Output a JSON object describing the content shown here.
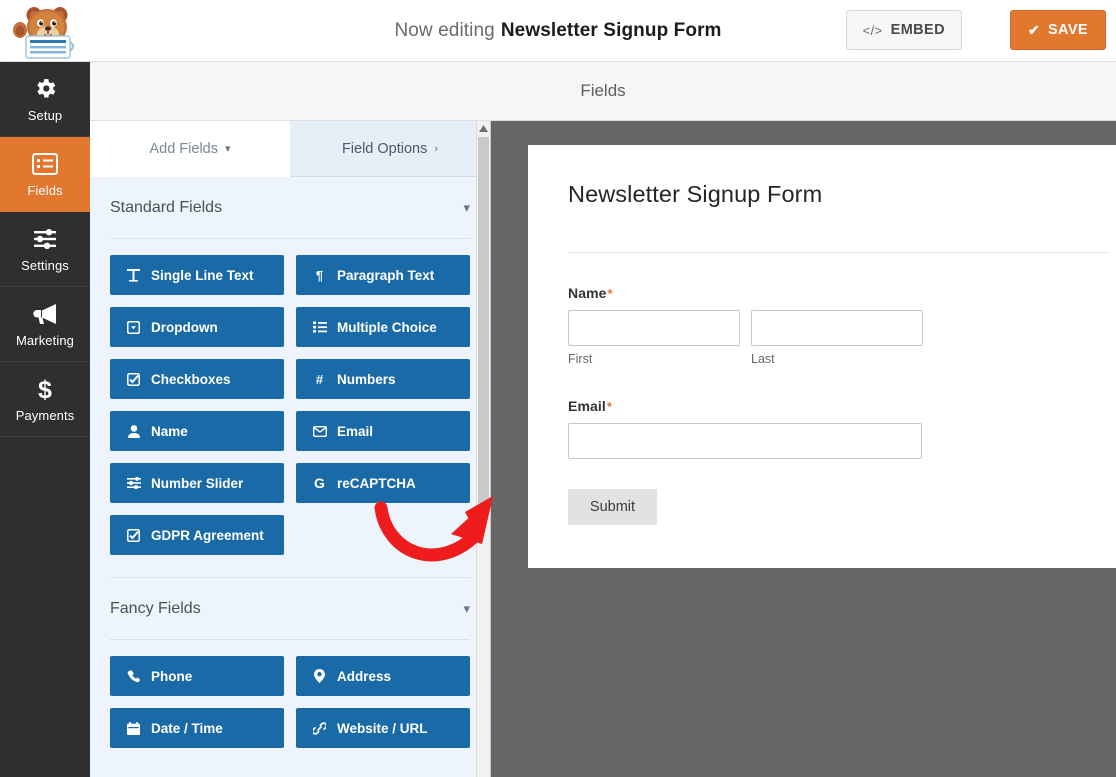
{
  "header": {
    "logo_alt": "wpforms-sullie-mascot",
    "now_editing_prefix": "Now editing",
    "form_name": "Newsletter Signup Form",
    "embed_label": "EMBED",
    "embed_icon": "code-icon",
    "save_label": "SAVE",
    "save_icon": "check-icon",
    "save_color": "#e27730"
  },
  "sidebar": {
    "items": [
      {
        "label": "Setup",
        "icon": "gear-icon",
        "active": false
      },
      {
        "label": "Fields",
        "icon": "list-icon",
        "active": true
      },
      {
        "label": "Settings",
        "icon": "sliders-icon",
        "active": false
      },
      {
        "label": "Marketing",
        "icon": "megaphone-icon",
        "active": false
      },
      {
        "label": "Payments",
        "icon": "dollar-icon",
        "active": false
      }
    ],
    "active_color": "#e27730",
    "background": "#2f2f2f"
  },
  "panel_header": {
    "title": "Fields"
  },
  "field_panel": {
    "tabs": [
      {
        "label": "Add Fields",
        "icon": "chevron-down-icon",
        "active": true
      },
      {
        "label": "Field Options",
        "icon": "chevron-right-icon",
        "active": false
      }
    ],
    "sections": [
      {
        "title": "Standard Fields",
        "caret": "chevron-down-icon",
        "fields": [
          {
            "label": "Single Line Text",
            "icon": "text-icon"
          },
          {
            "label": "Paragraph Text",
            "icon": "paragraph-icon"
          },
          {
            "label": "Dropdown",
            "icon": "dropdown-icon"
          },
          {
            "label": "Multiple Choice",
            "icon": "radio-list-icon"
          },
          {
            "label": "Checkboxes",
            "icon": "checkbox-icon"
          },
          {
            "label": "Numbers",
            "icon": "hash-icon"
          },
          {
            "label": "Name",
            "icon": "user-icon"
          },
          {
            "label": "Email",
            "icon": "envelope-icon"
          },
          {
            "label": "Number Slider",
            "icon": "slider-icon"
          },
          {
            "label": "reCAPTCHA",
            "icon": "google-g-icon"
          },
          {
            "label": "GDPR Agreement",
            "icon": "checkbox-icon"
          }
        ]
      },
      {
        "title": "Fancy Fields",
        "caret": "chevron-down-icon",
        "fields": [
          {
            "label": "Phone",
            "icon": "phone-icon"
          },
          {
            "label": "Address",
            "icon": "map-pin-icon"
          },
          {
            "label": "Date / Time",
            "icon": "calendar-icon"
          },
          {
            "label": "Website / URL",
            "icon": "link-icon"
          }
        ]
      }
    ],
    "button_color": "#1a6aa8"
  },
  "preview": {
    "form_title": "Newsletter Signup Form",
    "fields": [
      {
        "label": "Name",
        "required_marker": "*",
        "sub_inputs": [
          {
            "sub_label": "First",
            "value": "",
            "placeholder": ""
          },
          {
            "sub_label": "Last",
            "value": "",
            "placeholder": ""
          }
        ]
      },
      {
        "label": "Email",
        "required_marker": "*",
        "value": "",
        "placeholder": ""
      }
    ],
    "submit_label": "Submit",
    "background": "#666666"
  },
  "annotation": {
    "type": "red-curved-arrow",
    "color": "#ee1c1c"
  }
}
